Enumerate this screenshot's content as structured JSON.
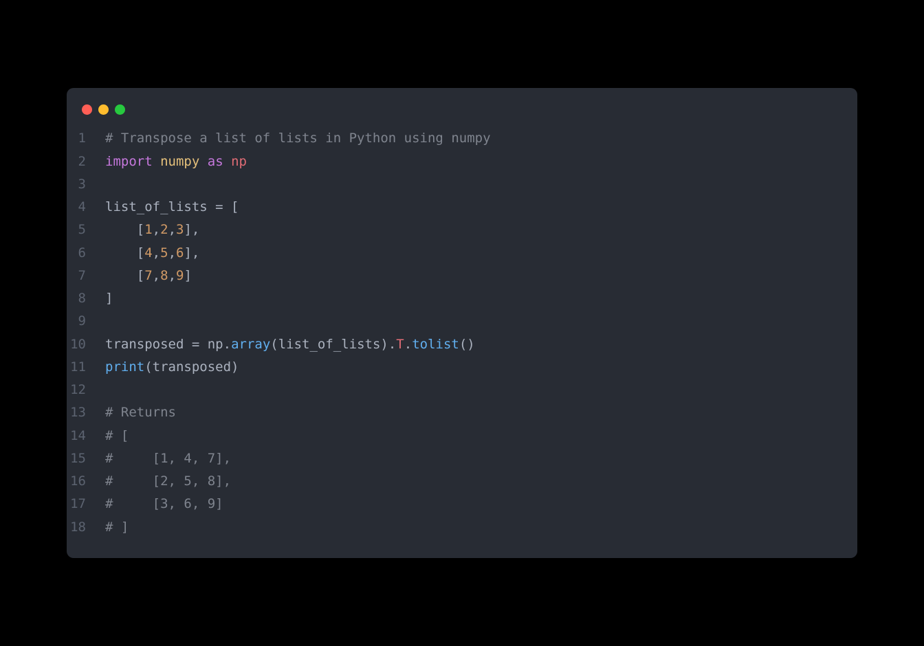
{
  "titlebar": {
    "close": "close",
    "minimize": "minimize",
    "zoom": "zoom"
  },
  "lines": [
    {
      "n": "1",
      "tokens": [
        {
          "cls": "comment",
          "t": "# Transpose a list of lists in Python using numpy"
        }
      ]
    },
    {
      "n": "2",
      "tokens": [
        {
          "cls": "import-kw",
          "t": "import"
        },
        {
          "cls": "default",
          "t": " "
        },
        {
          "cls": "module",
          "t": "numpy"
        },
        {
          "cls": "default",
          "t": " "
        },
        {
          "cls": "as-kw",
          "t": "as"
        },
        {
          "cls": "default",
          "t": " "
        },
        {
          "cls": "alias",
          "t": "np"
        }
      ]
    },
    {
      "n": "3",
      "tokens": []
    },
    {
      "n": "4",
      "tokens": [
        {
          "cls": "default",
          "t": "list_of_lists "
        },
        {
          "cls": "op",
          "t": "="
        },
        {
          "cls": "default",
          "t": " ["
        }
      ]
    },
    {
      "n": "5",
      "tokens": [
        {
          "cls": "default",
          "t": "    ["
        },
        {
          "cls": "num",
          "t": "1"
        },
        {
          "cls": "default",
          "t": ","
        },
        {
          "cls": "num",
          "t": "2"
        },
        {
          "cls": "default",
          "t": ","
        },
        {
          "cls": "num",
          "t": "3"
        },
        {
          "cls": "default",
          "t": "],"
        }
      ]
    },
    {
      "n": "6",
      "tokens": [
        {
          "cls": "default",
          "t": "    ["
        },
        {
          "cls": "num",
          "t": "4"
        },
        {
          "cls": "default",
          "t": ","
        },
        {
          "cls": "num",
          "t": "5"
        },
        {
          "cls": "default",
          "t": ","
        },
        {
          "cls": "num",
          "t": "6"
        },
        {
          "cls": "default",
          "t": "],"
        }
      ]
    },
    {
      "n": "7",
      "tokens": [
        {
          "cls": "default",
          "t": "    ["
        },
        {
          "cls": "num",
          "t": "7"
        },
        {
          "cls": "default",
          "t": ","
        },
        {
          "cls": "num",
          "t": "8"
        },
        {
          "cls": "default",
          "t": ","
        },
        {
          "cls": "num",
          "t": "9"
        },
        {
          "cls": "default",
          "t": "]"
        }
      ]
    },
    {
      "n": "8",
      "tokens": [
        {
          "cls": "default",
          "t": "]"
        }
      ]
    },
    {
      "n": "9",
      "tokens": []
    },
    {
      "n": "10",
      "tokens": [
        {
          "cls": "default",
          "t": "transposed "
        },
        {
          "cls": "op",
          "t": "="
        },
        {
          "cls": "default",
          "t": " np."
        },
        {
          "cls": "fn",
          "t": "array"
        },
        {
          "cls": "default",
          "t": "(list_of_lists)."
        },
        {
          "cls": "prop",
          "t": "T"
        },
        {
          "cls": "default",
          "t": "."
        },
        {
          "cls": "fn",
          "t": "tolist"
        },
        {
          "cls": "default",
          "t": "()"
        }
      ]
    },
    {
      "n": "11",
      "tokens": [
        {
          "cls": "builtin",
          "t": "print"
        },
        {
          "cls": "default",
          "t": "(transposed)"
        }
      ]
    },
    {
      "n": "12",
      "tokens": []
    },
    {
      "n": "13",
      "tokens": [
        {
          "cls": "comment",
          "t": "# Returns"
        }
      ]
    },
    {
      "n": "14",
      "tokens": [
        {
          "cls": "comment",
          "t": "# ["
        }
      ]
    },
    {
      "n": "15",
      "tokens": [
        {
          "cls": "comment",
          "t": "#     [1, 4, 7],"
        }
      ]
    },
    {
      "n": "16",
      "tokens": [
        {
          "cls": "comment",
          "t": "#     [2, 5, 8],"
        }
      ]
    },
    {
      "n": "17",
      "tokens": [
        {
          "cls": "comment",
          "t": "#     [3, 6, 9]"
        }
      ]
    },
    {
      "n": "18",
      "tokens": [
        {
          "cls": "comment",
          "t": "# ]"
        }
      ]
    }
  ]
}
